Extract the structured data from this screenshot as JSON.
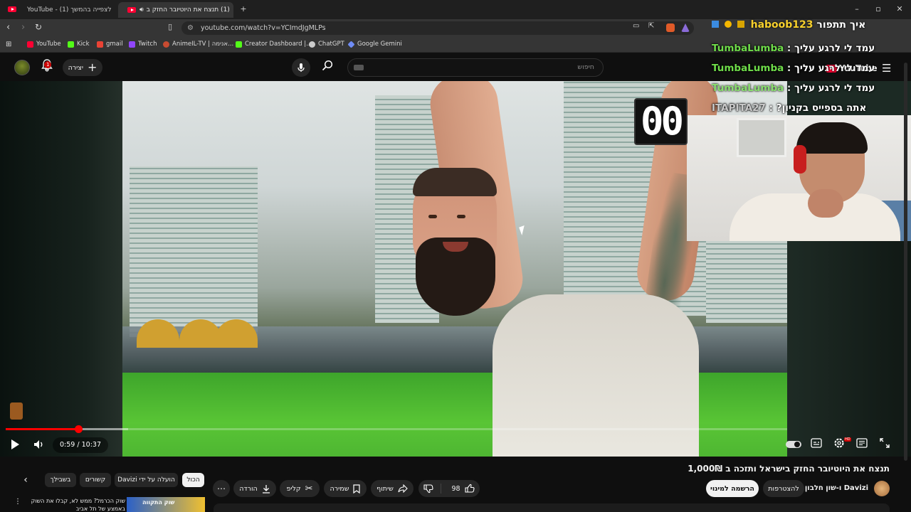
{
  "browser": {
    "tabs": [
      {
        "title": "YouTube - לצפייה בהמשך (1)",
        "active": false
      },
      {
        "title": "(1) תנצח את היוטיובר החזק ב",
        "active": true
      }
    ],
    "url": "youtube.com/watch?v=YCImdJgMLPs",
    "bookmarks": [
      "YouTube",
      "Kick",
      "gmail",
      "Twitch",
      "AnimeIL-TV | אנימה...",
      "Creator Dashboard |...",
      "ChatGPT",
      "Google Gemini"
    ]
  },
  "youtube_header": {
    "search_placeholder": "חיפוש",
    "create_label": "יצירה",
    "notification_count": "1",
    "logo_text": "YouTube"
  },
  "stream_overlay": {
    "header_user": "haboob123",
    "header_text": "איך תתפור",
    "chat": [
      {
        "user": "TumbaLumba",
        "message": "עמד לי לרגע עליך"
      },
      {
        "user": "TumbaLumba",
        "message": "עמד לי לרגע עליך"
      },
      {
        "user": "TumbaLumba",
        "message": "עמד לי לרגע עליך"
      },
      {
        "user": "ITAPITA27",
        "message": "?אתה בספייס בקניון"
      }
    ],
    "timer_text": "00"
  },
  "player": {
    "current_time": "0:59",
    "duration": "10:37",
    "progress_fraction": 0.0926,
    "buffer_fraction": 0.157
  },
  "video": {
    "title": "תנצח את היוטיובר החזק בישראל ותזכה ב 1,000₪",
    "channel": "Davizi ו-שון חלבון",
    "subscribe_label": "הרשמה למינוי",
    "join_label": "להצטרפות",
    "like_count": "98",
    "share_label": "שיתוף",
    "save_label": "שמירה",
    "clip_label": "קליפ",
    "download_label": "הורדה",
    "more_label": "⋯"
  },
  "chips": {
    "all": "הכול",
    "uploaded_by": "הועלה על ידי Davizi",
    "related": "קשורים",
    "for_you": "בשבילך"
  },
  "recommendation": {
    "title": "שוק הכרמל? ממש לא, קבלו את השוק באמצע של תל אביב",
    "thumb_text": "שוק התקווה"
  }
}
